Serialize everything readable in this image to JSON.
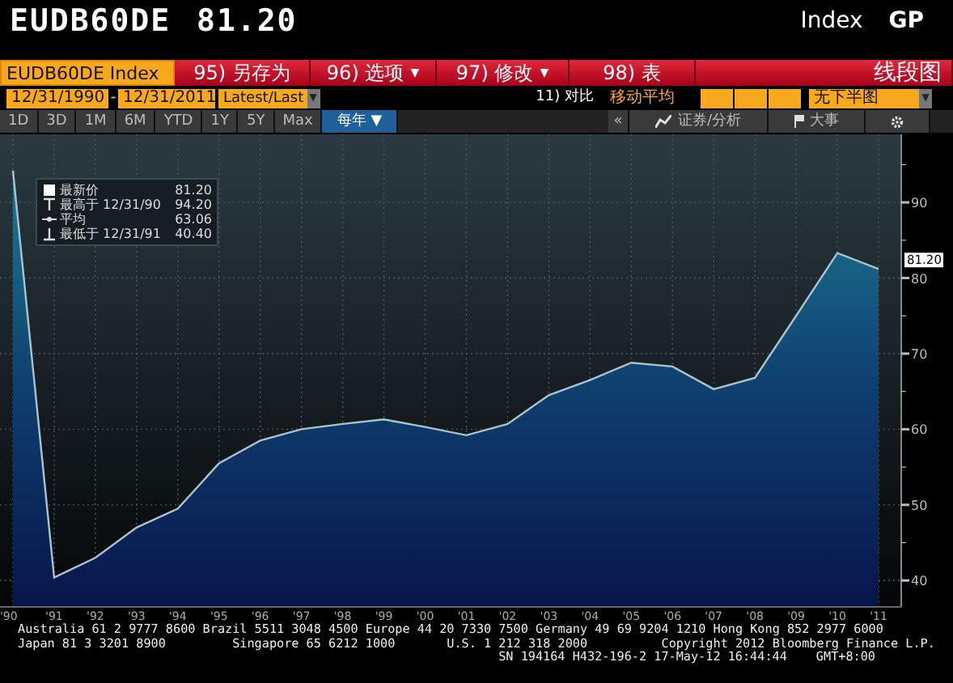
{
  "header": {
    "ticker": "EUDB60DE",
    "value": "81.20",
    "type": "Index",
    "function": "GP"
  },
  "toolbar": {
    "security": "EUDB60DE Index",
    "buttons": [
      {
        "number": "95)",
        "label": "另存为"
      },
      {
        "number": "96)",
        "label": "选项",
        "caret": "▼"
      },
      {
        "number": "97)",
        "label": "修改",
        "caret": "▼"
      },
      {
        "number": "98)",
        "label": "表"
      }
    ],
    "chart_type": "线段图"
  },
  "range": {
    "start": "12/31/1990",
    "separator": "-",
    "end": "12/31/2011",
    "mode": "Latest/Last",
    "mode_caret": "▼",
    "compare": "11) 对比",
    "moving_average": "移动平均",
    "lower_chart": "无下半图",
    "lower_chart_caret": "▼"
  },
  "periods": [
    {
      "label": "1D",
      "selected": false
    },
    {
      "label": "3D",
      "selected": false
    },
    {
      "label": "1M",
      "selected": false
    },
    {
      "label": "6M",
      "selected": false
    },
    {
      "label": "YTD",
      "selected": false
    },
    {
      "label": "1Y",
      "selected": false
    },
    {
      "label": "5Y",
      "selected": false
    },
    {
      "label": "Max",
      "selected": false
    },
    {
      "label": "每年 ▼",
      "selected": true
    }
  ],
  "side_tools": {
    "collapse": "«",
    "analysis": "证券/分析",
    "events": "大事"
  },
  "legend": [
    {
      "kind": "last",
      "label": "最新价",
      "value": "81.20"
    },
    {
      "kind": "high",
      "label": "最高于",
      "date": "12/31/90",
      "value": "94.20"
    },
    {
      "kind": "average",
      "label": "平均",
      "value": "63.06"
    },
    {
      "kind": "low",
      "label": "最低于",
      "date": "12/31/91",
      "value": "40.40"
    }
  ],
  "chart_data": {
    "type": "area",
    "categories": [
      "'90",
      "'91",
      "'92",
      "'93",
      "'94",
      "'95",
      "'96",
      "'97",
      "'98",
      "'99",
      "'00",
      "'01",
      "'02",
      "'03",
      "'04",
      "'05",
      "'06",
      "'07",
      "'08",
      "'09",
      "'10",
      "'11"
    ],
    "series": [
      {
        "color": "#a9c3cc",
        "values": [
          94.2,
          40.4,
          43,
          47,
          49.5,
          55.5,
          58.5,
          60,
          60.7,
          61.3,
          60.3,
          59.2,
          60.7,
          64.5,
          66.5,
          68.8,
          68.3,
          65.3,
          66.8,
          75,
          83.3,
          81.2
        ]
      }
    ],
    "ylim": [
      36.5,
      99
    ],
    "yticks": [
      40,
      50,
      60,
      70,
      80,
      90
    ],
    "grid": true,
    "annotations": [
      "81.20"
    ]
  },
  "footer": [
    "Australia 61 2 9777 8600 Brazil 5511 3048 4500 Europe 44 20 7330 7500 Germany 49 69 9204 1210 Hong Kong 852 2977 6000",
    "Japan 81 3 3201 8900         Singapore 65 6212 1000       U.S. 1 212 318 2000          Copyright 2012 Bloomberg Finance L.P.",
    "SN 194164 H432-196-2 17-May-12 16:44:44"
  ],
  "timezone": "GMT+8:00"
}
